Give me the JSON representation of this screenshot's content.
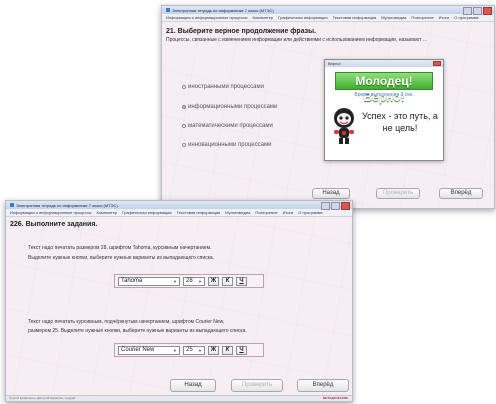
{
  "back_window": {
    "title": "Электронная тетрадь по информатике 7 класс (МТЭС)",
    "menu": [
      "Информация и информационные процессы",
      "Компьютер",
      "Графическая информация",
      "Текстовая информация",
      "Мультимедиа",
      "Повторение",
      "Итоги",
      "О программе"
    ],
    "task_title": "21. Выберите верное продолжение фразы.",
    "question": "Процессы, связанные с изменением информации или действиями с использованием информации, называют ...",
    "options": [
      {
        "label": "иностранными процессами",
        "checked": false
      },
      {
        "label": "информационными процессами",
        "checked": true
      },
      {
        "label": "математическими процессами",
        "checked": false
      },
      {
        "label": "инновационными процессами",
        "checked": false
      }
    ],
    "popup": {
      "title": "Верно!",
      "banner": "Молодец! Верно!",
      "time": "Время выполнения 3 сек.",
      "message": "Успех - это путь, а не цель!"
    },
    "buttons": {
      "back": "Назад",
      "check": "Проверить",
      "next": "Вперёд"
    }
  },
  "front_window": {
    "title": "Электронная тетрадь по информатике 7 класс (МТЭС)",
    "menu": [
      "Информация и информационные процессы",
      "Компьютер",
      "Графическая информация",
      "Текстовая информация",
      "Мультимедиа",
      "Повторение",
      "Итоги",
      "О программе"
    ],
    "task_title": "226. Выполните задания.",
    "task1_line1": "Текст надо печатать размером 28, шрифтом Tahoma, курсивным начертанием.",
    "task1_line2": "Выделите нужные кнопки, выберите нужные варианты из выпадающего списка.",
    "task2_line1": "Текст надо печатать курсивным, подчёркнутым начертанием, шрифтом Courier New,",
    "task2_line2": "размером 25. Выделите нужные кнопки, выберите нужные варианты из выпадающего списка.",
    "row1": {
      "font": "Tahoma",
      "size": "28",
      "bold": "Ж",
      "italic": "К",
      "underline": "Ч"
    },
    "row2": {
      "font": "Courier New",
      "size": "25",
      "bold": "Ж",
      "italic": "К",
      "underline": "Ч"
    },
    "buttons": {
      "back": "Назад",
      "check": "Проверить",
      "next": "Вперёд"
    },
    "status": "Сергей Кривошеин, Дмитрий Шумилин, Андрей ...",
    "logo": "МЕТОДИЧЕСКИЕ"
  }
}
